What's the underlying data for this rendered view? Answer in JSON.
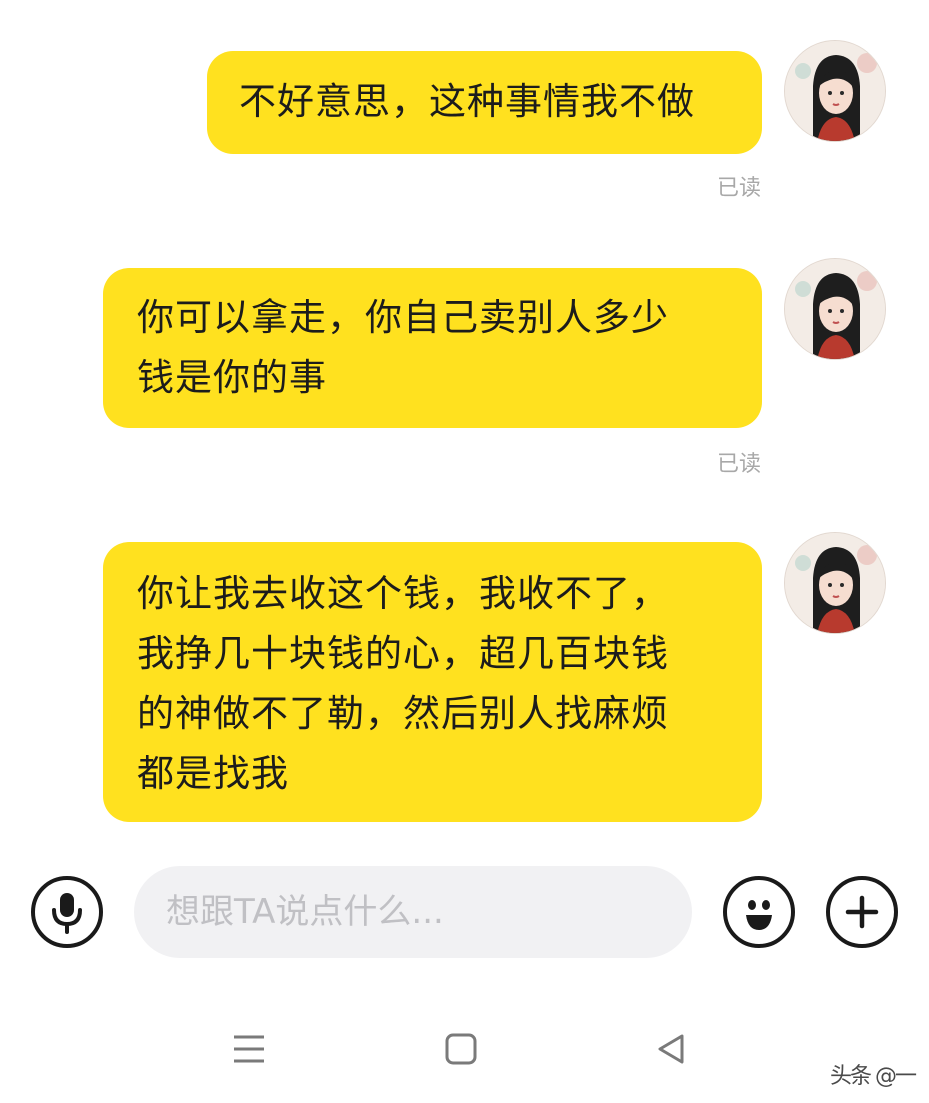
{
  "colors": {
    "bubble": "#ffe11f",
    "read": "#a8a8a8",
    "input_bg": "#f1f1f3"
  },
  "messages": [
    {
      "lines": [
        "不好意思，这种事情我不做"
      ],
      "status": "已读"
    },
    {
      "lines": [
        "你可以拿走，你自己卖别人多少",
        "钱是你的事"
      ],
      "status": "已读"
    },
    {
      "lines": [
        "你让我去收这个钱，我收不了，",
        "我挣几十块钱的心，超几百块钱",
        "的神做不了勒，然后别人找麻烦",
        "都是找我"
      ],
      "status": ""
    }
  ],
  "input_bar": {
    "voice_icon": "microphone-icon",
    "placeholder": "想跟TA说点什么...",
    "emoji_icon": "smiley-icon",
    "add_icon": "plus-icon"
  },
  "nav": {
    "menu_icon": "menu-icon",
    "home_icon": "home-square-icon",
    "back_icon": "back-triangle-icon"
  },
  "watermark": "头条 @一"
}
